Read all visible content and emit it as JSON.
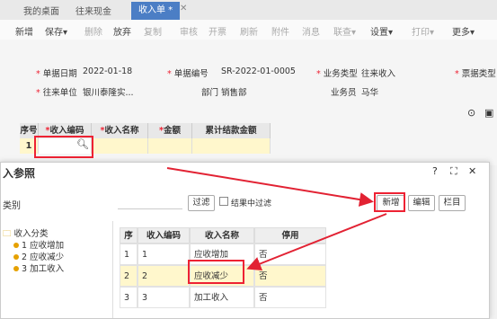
{
  "tabs": [
    "我的桌面",
    "往来现金",
    "收入单 *"
  ],
  "toolbar": {
    "items": [
      "新增",
      "保存▾",
      "删除",
      "放弃",
      "复制",
      "审核",
      "开票",
      "刷新",
      "附件",
      "消息",
      "联查▾",
      "设置▾",
      "打印▾",
      "更多▾"
    ]
  },
  "form": {
    "doc_date_label": "单据日期",
    "doc_date": "2022-01-18",
    "doc_no_label": "单据编号",
    "doc_no": "SR-2022-01-0005",
    "biz_type_label": "业务类型",
    "biz_type": "往来收入",
    "bill_type_label": "票据类型",
    "partner_label": "往来单位",
    "partner": "银川泰隆实...",
    "dept_label": "部门",
    "dept": "销售部",
    "staff_label": "业务员",
    "staff": "马华"
  },
  "grid": {
    "headers": [
      "序号",
      "收入编码",
      "收入名称",
      "金额",
      "累计结款金额"
    ],
    "row_no": "1"
  },
  "dialog": {
    "title": "入参照",
    "category_label": "类别",
    "filter_btn": "过滤",
    "filter_in_result": "结果中过滤",
    "new_btn": "新增",
    "edit_btn": "编辑",
    "column_btn": "栏目",
    "tree": {
      "root": "收入分类",
      "items": [
        "1 应收增加",
        "2 应收减少",
        "3 加工收入"
      ]
    },
    "table": {
      "headers": [
        "序号",
        "收入编码",
        "收入名称",
        "停用"
      ],
      "rows": [
        {
          "no": "1",
          "code": "1",
          "name": "应收增加",
          "disabled": "否"
        },
        {
          "no": "2",
          "code": "2",
          "name": "应收减少",
          "disabled": "否"
        },
        {
          "no": "3",
          "code": "3",
          "name": "加工收入",
          "disabled": "否"
        }
      ]
    }
  },
  "colors": {
    "accent": "#4b7ec5",
    "annotation": "#e22233"
  }
}
